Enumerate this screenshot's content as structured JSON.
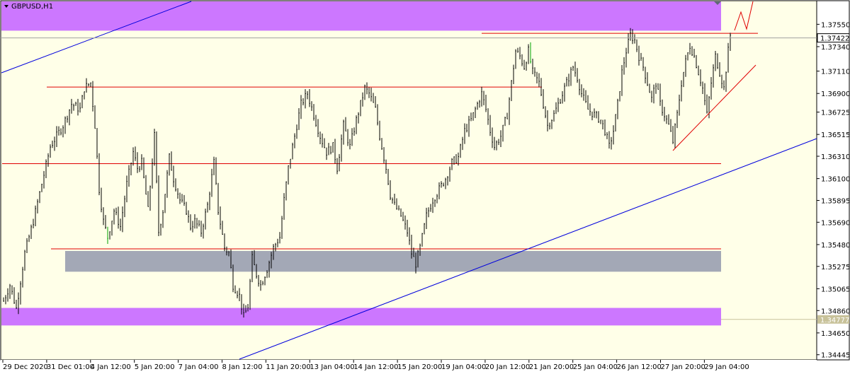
{
  "window": {
    "title": "GBPUSD,H1",
    "menu_icon": "triangle-down-icon",
    "corner_icon": "diamond-icon"
  },
  "colors": {
    "background": "#ffffe8",
    "frame": "#000000",
    "candle": "#000000",
    "candle_last": "#00a000",
    "zone_magenta": "#cc77ff",
    "zone_gray": "#a3a8b6",
    "level_red": "#e00000",
    "trend_blue": "#0000dd",
    "bid_line": "#a0a0a0",
    "marker_line": "#c8c29a"
  },
  "chart_data": {
    "type": "candlestick",
    "symbol": "GBPUSD",
    "timeframe": "H1",
    "ylim": [
      1.3441,
      1.37765
    ],
    "y_ticks": [
      "1.37550",
      "1.37340",
      "1.37110",
      "1.36900",
      "1.36725",
      "1.36515",
      "1.36310",
      "1.36100",
      "1.35895",
      "1.35690",
      "1.35480",
      "1.35275",
      "1.35065",
      "1.34860",
      "1.34650",
      "1.34445"
    ],
    "x_ticks": [
      "29 Dec 2020",
      "31 Dec 01:00",
      "4 Jan 12:00",
      "5 Jan 20:00",
      "7 Jan 04:00",
      "8 Jan 12:00",
      "11 Jan 20:00",
      "13 Jan 04:00",
      "14 Jan 12:00",
      "15 Jan 20:00",
      "19 Jan 04:00",
      "20 Jan 12:00",
      "21 Jan 20:00",
      "25 Jan 04:00",
      "26 Jan 12:00",
      "27 Jan 20:00",
      "29 Jan 04:00"
    ],
    "bar_count": 343,
    "price_path": [
      [
        0,
        1.3495
      ],
      [
        3,
        1.351
      ],
      [
        6,
        1.3488
      ],
      [
        10,
        1.354
      ],
      [
        14,
        1.357
      ],
      [
        18,
        1.3605
      ],
      [
        22,
        1.364
      ],
      [
        28,
        1.366
      ],
      [
        32,
        1.368
      ],
      [
        36,
        1.3675
      ],
      [
        38,
        1.3695
      ],
      [
        41,
        1.37
      ],
      [
        43,
        1.366
      ],
      [
        45,
        1.36
      ],
      [
        47,
        1.357
      ],
      [
        49,
        1.3555
      ],
      [
        52,
        1.358
      ],
      [
        55,
        1.3565
      ],
      [
        58,
        1.3605
      ],
      [
        61,
        1.3635
      ],
      [
        63,
        1.362
      ],
      [
        65,
        1.3625
      ],
      [
        68,
        1.358
      ],
      [
        71,
        1.365
      ],
      [
        73,
        1.356
      ],
      [
        75,
        1.358
      ],
      [
        78,
        1.363
      ],
      [
        80,
        1.361
      ],
      [
        83,
        1.359
      ],
      [
        86,
        1.358
      ],
      [
        88,
        1.3565
      ],
      [
        90,
        1.357
      ],
      [
        93,
        1.356
      ],
      [
        96,
        1.3585
      ],
      [
        99,
        1.3625
      ],
      [
        101,
        1.358
      ],
      [
        104,
        1.3545
      ],
      [
        106,
        1.354
      ],
      [
        108,
        1.351
      ],
      [
        111,
        1.35
      ],
      [
        113,
        1.348
      ],
      [
        115,
        1.349
      ],
      [
        117,
        1.3535
      ],
      [
        119,
        1.352
      ],
      [
        121,
        1.351
      ],
      [
        124,
        1.3525
      ],
      [
        127,
        1.3545
      ],
      [
        130,
        1.3555
      ],
      [
        132,
        1.359
      ],
      [
        134,
        1.362
      ],
      [
        137,
        1.365
      ],
      [
        140,
        1.368
      ],
      [
        143,
        1.369
      ],
      [
        146,
        1.367
      ],
      [
        149,
        1.365
      ],
      [
        152,
        1.3635
      ],
      [
        155,
        1.364
      ],
      [
        157,
        1.362
      ],
      [
        160,
        1.366
      ],
      [
        163,
        1.364
      ],
      [
        166,
        1.3665
      ],
      [
        168,
        1.368
      ],
      [
        170,
        1.3695
      ],
      [
        172,
        1.369
      ],
      [
        175,
        1.3675
      ],
      [
        177,
        1.365
      ],
      [
        180,
        1.362
      ],
      [
        182,
        1.3595
      ],
      [
        184,
        1.3585
      ],
      [
        187,
        1.3575
      ],
      [
        190,
        1.356
      ],
      [
        192,
        1.354
      ],
      [
        194,
        1.353
      ],
      [
        196,
        1.3545
      ],
      [
        199,
        1.3575
      ],
      [
        202,
        1.359
      ],
      [
        205,
        1.36
      ],
      [
        208,
        1.361
      ],
      [
        211,
        1.3625
      ],
      [
        214,
        1.363
      ],
      [
        217,
        1.3655
      ],
      [
        220,
        1.3665
      ],
      [
        223,
        1.368
      ],
      [
        225,
        1.369
      ],
      [
        227,
        1.3675
      ],
      [
        229,
        1.3655
      ],
      [
        231,
        1.364
      ],
      [
        234,
        1.365
      ],
      [
        237,
        1.367
      ],
      [
        239,
        1.37
      ],
      [
        241,
        1.373
      ],
      [
        243,
        1.3725
      ],
      [
        245,
        1.3715
      ],
      [
        247,
        1.373
      ],
      [
        249,
        1.371
      ],
      [
        252,
        1.37
      ],
      [
        254,
        1.368
      ],
      [
        256,
        1.366
      ],
      [
        259,
        1.367
      ],
      [
        262,
        1.3685
      ],
      [
        265,
        1.37
      ],
      [
        268,
        1.3715
      ],
      [
        270,
        1.3705
      ],
      [
        272,
        1.369
      ],
      [
        275,
        1.3675
      ],
      [
        278,
        1.367
      ],
      [
        281,
        1.3665
      ],
      [
        283,
        1.3655
      ],
      [
        285,
        1.364
      ],
      [
        287,
        1.3655
      ],
      [
        289,
        1.368
      ],
      [
        291,
        1.371
      ],
      [
        293,
        1.373
      ],
      [
        295,
        1.3745
      ],
      [
        297,
        1.374
      ],
      [
        299,
        1.3725
      ],
      [
        301,
        1.3715
      ],
      [
        303,
        1.37
      ],
      [
        305,
        1.3685
      ],
      [
        307,
        1.37
      ],
      [
        309,
        1.368
      ],
      [
        311,
        1.367
      ],
      [
        313,
        1.366
      ],
      [
        315,
        1.3645
      ],
      [
        317,
        1.367
      ],
      [
        319,
        1.37
      ],
      [
        321,
        1.372
      ],
      [
        323,
        1.3735
      ],
      [
        325,
        1.3725
      ],
      [
        327,
        1.371
      ],
      [
        329,
        1.3695
      ],
      [
        331,
        1.367
      ],
      [
        333,
        1.37
      ],
      [
        335,
        1.3725
      ],
      [
        337,
        1.371
      ],
      [
        339,
        1.3695
      ],
      [
        341,
        1.373
      ],
      [
        342,
        1.3745
      ]
    ],
    "zones": [
      {
        "top": 1.37765,
        "bottom": 1.3749,
        "color": "magenta"
      },
      {
        "top": 1.3542,
        "bottom": 1.35225,
        "color": "gray"
      },
      {
        "top": 1.34885,
        "bottom": 1.3472,
        "color": "magenta"
      }
    ],
    "horizontal_levels": [
      1.37465,
      1.3696,
      1.3624,
      1.3544
    ],
    "price_markers": [
      {
        "label": "1.37422",
        "value": 1.37422,
        "style": "bid"
      },
      {
        "label": "1.34777",
        "value": 1.34777,
        "style": "level"
      }
    ]
  }
}
